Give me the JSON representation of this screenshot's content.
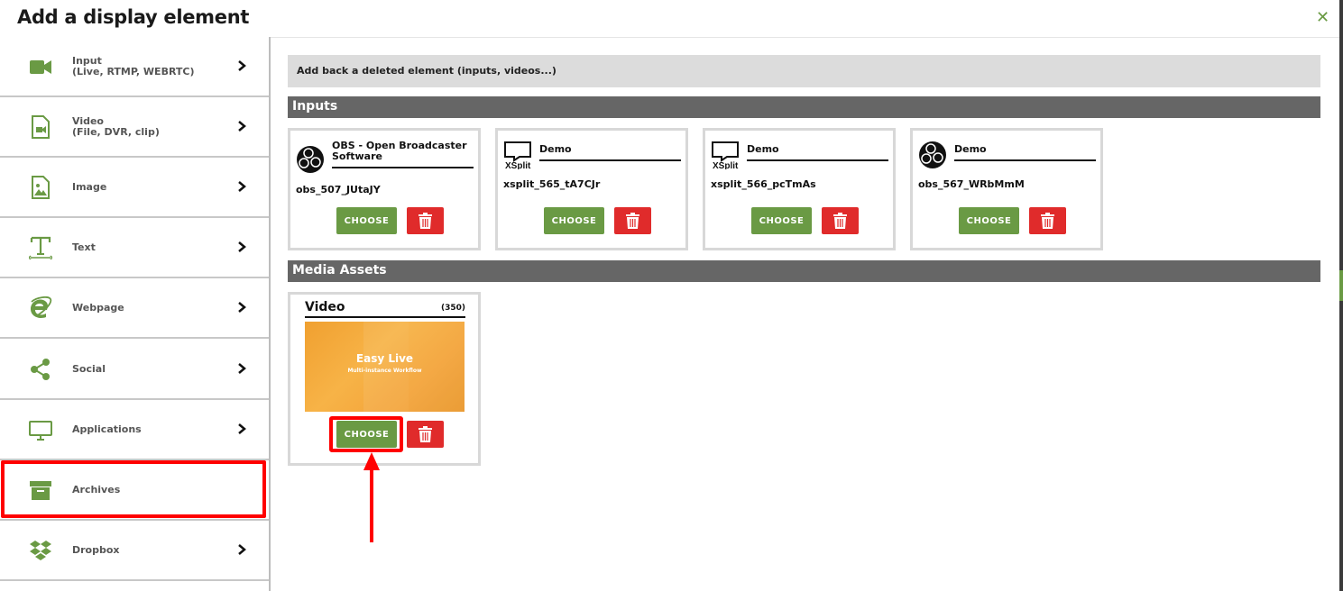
{
  "header": {
    "title": "Add a display element",
    "close_label": "✕"
  },
  "sidebar": {
    "items": [
      {
        "key": "input",
        "label": "Input",
        "sublabel": "(Live, RTMP, WEBRTC)",
        "icon": "video-camera-icon",
        "has_chevron": true
      },
      {
        "key": "video",
        "label": "Video",
        "sublabel": "(File, DVR, clip)",
        "icon": "video-file-icon",
        "has_chevron": true
      },
      {
        "key": "image",
        "label": "Image",
        "sublabel": "",
        "icon": "image-file-icon",
        "has_chevron": true
      },
      {
        "key": "text",
        "label": "Text",
        "sublabel": "",
        "icon": "text-icon",
        "has_chevron": true
      },
      {
        "key": "webpage",
        "label": "Webpage",
        "sublabel": "",
        "icon": "internet-explorer-icon",
        "has_chevron": true
      },
      {
        "key": "social",
        "label": "Social",
        "sublabel": "",
        "icon": "share-icon",
        "has_chevron": true
      },
      {
        "key": "applications",
        "label": "Applications",
        "sublabel": "",
        "icon": "monitor-icon",
        "has_chevron": true
      },
      {
        "key": "archives",
        "label": "Archives",
        "sublabel": "",
        "icon": "archive-box-icon",
        "has_chevron": false
      },
      {
        "key": "dropbox",
        "label": "Dropbox",
        "sublabel": "",
        "icon": "dropbox-icon",
        "has_chevron": true
      }
    ]
  },
  "main": {
    "top_bar_label": "Add back a deleted element (inputs, videos...)",
    "inputs_section": {
      "title": "Inputs",
      "cards": [
        {
          "title": "OBS - Open Broadcaster Software",
          "name": "obs_507_JUtaJY",
          "logo": "obs-logo-icon",
          "choose_label": "CHOOSE"
        },
        {
          "title": "Demo",
          "name": "xsplit_565_tA7CJr",
          "logo": "xsplit-logo-icon",
          "choose_label": "CHOOSE"
        },
        {
          "title": "Demo",
          "name": "xsplit_566_pcTmAs",
          "logo": "xsplit-logo-icon",
          "choose_label": "CHOOSE"
        },
        {
          "title": "Demo",
          "name": "obs_567_WRbMmM",
          "logo": "obs-logo-icon",
          "choose_label": "CHOOSE"
        }
      ]
    },
    "media_section": {
      "title": "Media Assets",
      "card": {
        "title": "Video",
        "count": "(350)",
        "thumbnail_title": "Easy Live",
        "thumbnail_subtitle": "Multi-instance Workflow",
        "choose_label": "CHOOSE"
      }
    }
  },
  "colors": {
    "accent_green": "#6a9a44",
    "delete_red": "#e02b2b",
    "section_gray": "#666666",
    "highlight_red": "#ff0000"
  }
}
